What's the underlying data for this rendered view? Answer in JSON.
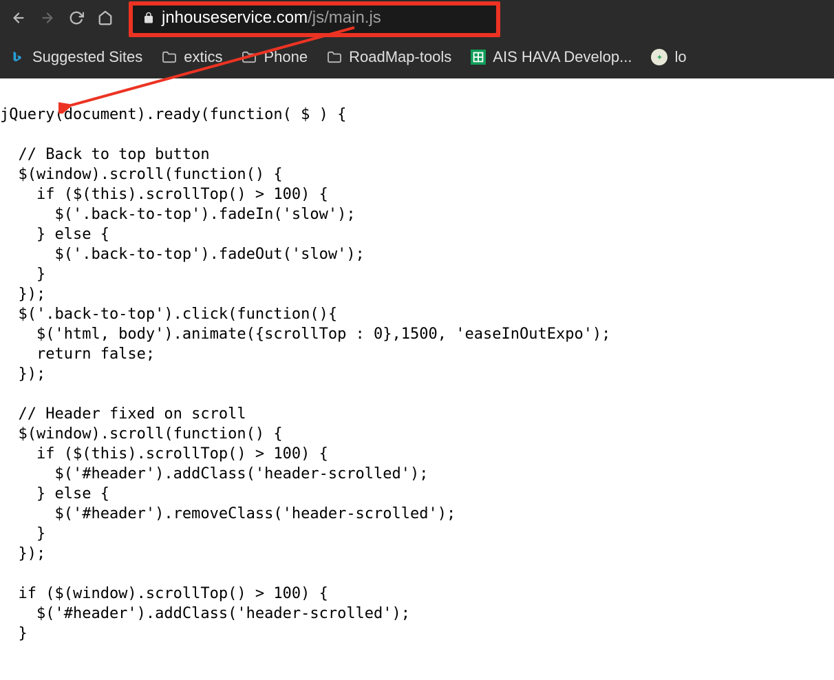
{
  "url": {
    "host": "jnhouseservice.com",
    "path": "/js/main.js"
  },
  "bookmarks": {
    "b0": "Suggested Sites",
    "b1": "extics",
    "b2": "Phone",
    "b3": "RoadMap-tools",
    "b4": "AIS HAVA Develop...",
    "b5": "lo"
  },
  "code": "jQuery(document).ready(function( $ ) {\n\n  // Back to top button\n  $(window).scroll(function() {\n    if ($(this).scrollTop() > 100) {\n      $('.back-to-top').fadeIn('slow');\n    } else {\n      $('.back-to-top').fadeOut('slow');\n    }\n  });\n  $('.back-to-top').click(function(){\n    $('html, body').animate({scrollTop : 0},1500, 'easeInOutExpo');\n    return false;\n  });\n\n  // Header fixed on scroll\n  $(window).scroll(function() {\n    if ($(this).scrollTop() > 100) {\n      $('#header').addClass('header-scrolled');\n    } else {\n      $('#header').removeClass('header-scrolled');\n    }\n  });\n\n  if ($(window).scrollTop() > 100) {\n    $('#header').addClass('header-scrolled');\n  }"
}
